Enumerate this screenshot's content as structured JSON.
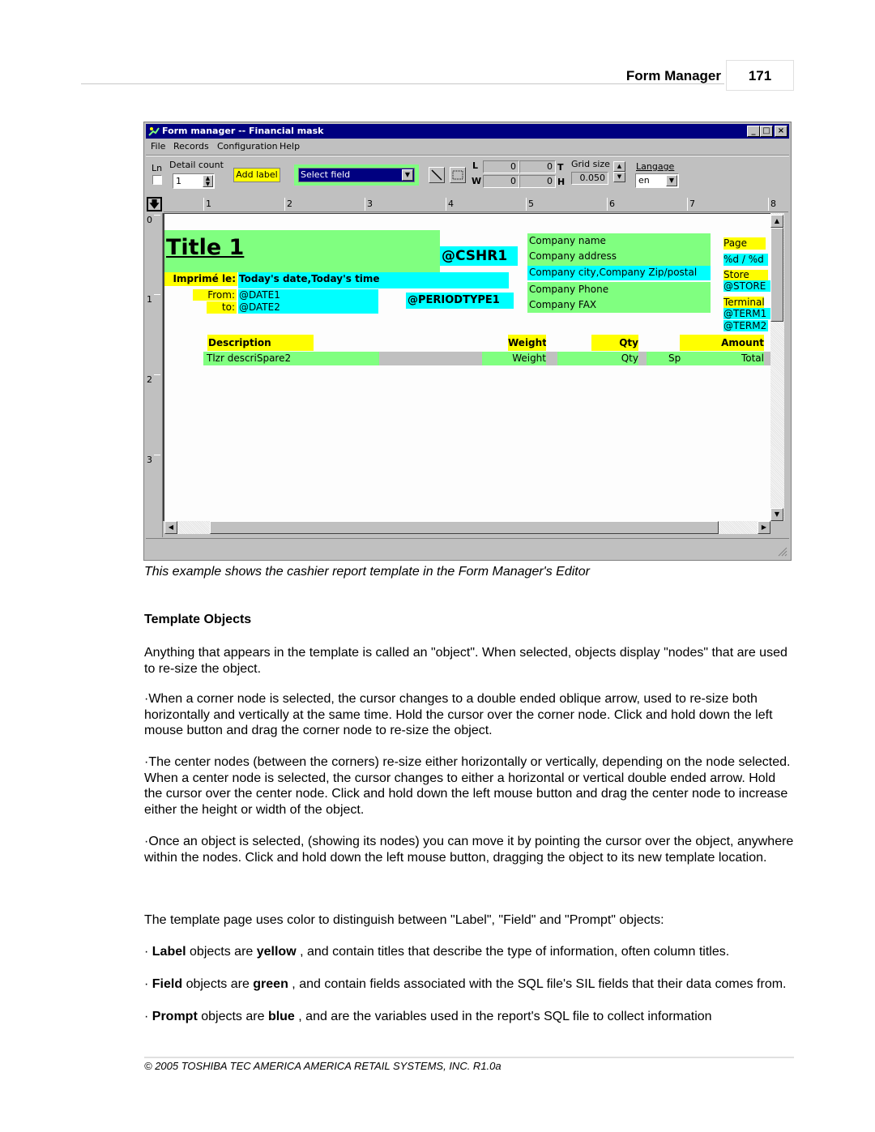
{
  "page_header": {
    "section_title": "Form Manager",
    "page_number": "171"
  },
  "window": {
    "title": "Form manager -- Financial mask",
    "controls": {
      "minimize": "_",
      "maximize": "□",
      "close": "×"
    },
    "menu": [
      "File",
      "Records",
      "Configuration",
      "Help"
    ],
    "toolbar": {
      "ln_label": "Ln",
      "ln_checked": false,
      "detail_count_label": "Detail count",
      "detail_count_value": "1",
      "add_label_button": "Add label",
      "select_field_value": "Select field",
      "line_tool_icon": "diagonal-line-icon",
      "rect_tool_icon": "dotted-rectangle-icon",
      "L_label": "L",
      "L_value": "0",
      "T_label": "T",
      "T_value": "0",
      "W_label": "W",
      "W_value": "0",
      "H_label": "H",
      "H_value": "0",
      "grid_size_label": "Grid size",
      "grid_size_value": "0.050",
      "language_label": "Langage",
      "language_value": "en"
    },
    "ruler_h": [
      "1",
      "2",
      "3",
      "4",
      "5",
      "6",
      "7",
      "8"
    ],
    "ruler_v": [
      "0",
      "1",
      "2",
      "3"
    ],
    "colors": {
      "label": "#ffff00",
      "field": "#80ff80",
      "prompt": "#00ffff",
      "titlebar": "#000080"
    },
    "template": {
      "title": "Title 1",
      "cashier": "@CSHR1",
      "printed_label": "Imprimé le:",
      "printed_value": "Today's date,Today's time",
      "from_label": "From:",
      "from_value": "@DATE1",
      "to_label": "to:",
      "to_value": "@DATE2",
      "period": "@PERIODTYPE1",
      "company": [
        "Company name",
        "Company address",
        "Company city,Company Zip/postal",
        "Company Phone",
        "Company FAX"
      ],
      "page_label": "Page",
      "page_value": "%d / %d",
      "store_label": "Store",
      "store_value": "@STORE",
      "terminal_label": "Terminal",
      "terminal_values": [
        "@TERM1",
        "@TERM2"
      ],
      "columns": {
        "description": "Description",
        "weight": "Weight",
        "qty": "Qty",
        "amount": "Amount"
      },
      "detail_row": {
        "description": "Tlzr descriSpare2",
        "weight": "Weight",
        "qty": "Qty",
        "sp": "Sp",
        "total": "Total"
      }
    }
  },
  "caption": "This example shows the cashier report template in the Form Manager's Editor",
  "section_heading": "Template Objects",
  "paragraphs": [
    " Anything that appears in the template is called an \"object\". When selected, objects display \"nodes\" that are used to re-size the object.",
    "·When a corner node is selected, the cursor changes to a double ended oblique arrow, used to re-size both horizontally and vertically at the same time. Hold the cursor over the corner node. Click and hold down the left mouse button and drag the corner node to re-size the object.",
    "·The center nodes (between the corners) re-size either horizontally or vertically, depending on the node selected. When a center node is selected, the cursor changes to either a horizontal or vertical double ended arrow. Hold the cursor over the center node. Click and hold down the left mouse button and drag the center node to increase either the height or width of the object.",
    "·Once an object is selected, (showing its nodes) you can move it by pointing the cursor over the object, anywhere within the nodes. Click and hold down the left mouse button, dragging the object to its new template location.",
    " The template page uses color to distinguish between \"Label\", \"Field\" and \"Prompt\" objects:"
  ],
  "bullets": [
    {
      "prefix": " ·  ",
      "term": "Label",
      "mid": "  objects are ",
      "color_word": "yellow",
      "rest": " , and contain titles that describe the type of information, often column titles."
    },
    {
      "prefix": " · ",
      "term": "Field",
      "mid": "  objects are ",
      "color_word": "green",
      "rest": " , and contain fields associated with the SQL file's SIL fields that their data comes from."
    },
    {
      "prefix": " · ",
      "term": "Prompt",
      "mid": "  objects are ",
      "color_word": "blue",
      "rest": " , and are the variables used in the report's SQL file to collect information"
    }
  ],
  "footer": "© 2005 TOSHIBA TEC AMERICA AMERICA RETAIL SYSTEMS, INC.   R1.0a"
}
